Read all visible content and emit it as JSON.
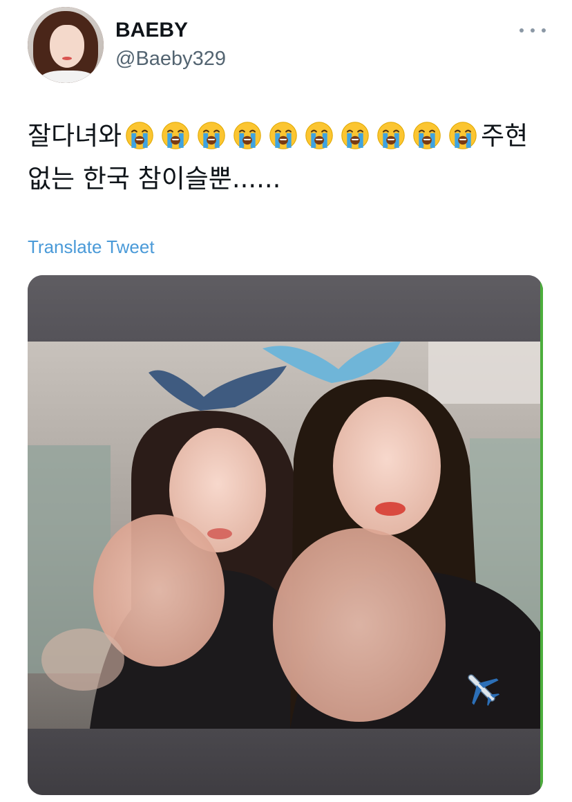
{
  "author": {
    "display_name": "BAEBY",
    "handle": "@Baeby329"
  },
  "tweet": {
    "text_before_emoji": "잘다녀와",
    "emoji_name": "loudly-crying-face",
    "emoji_count": 10,
    "text_after_emoji": "주현 없는 한국 참이슬뿐......",
    "translate_label": "Translate Tweet"
  },
  "media": {
    "overlay_icon": "airplane-icon"
  },
  "colors": {
    "link": "#4a9ad8",
    "secondary_text": "#536471",
    "media_bar": "#4e4c50"
  }
}
